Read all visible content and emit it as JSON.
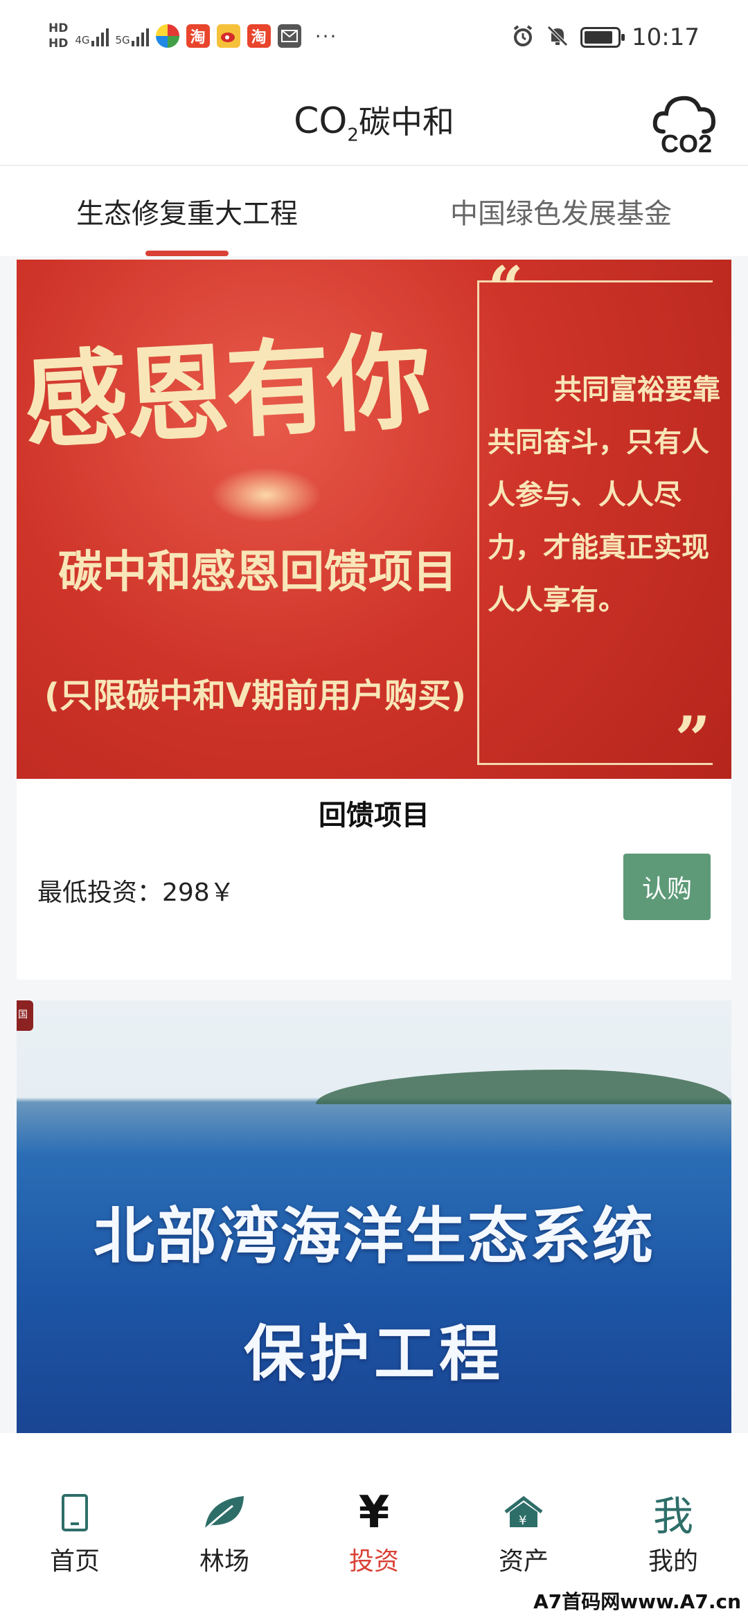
{
  "status_bar": {
    "hd1": "HD",
    "hd2": "HD",
    "net1": "4G",
    "net2": "5G",
    "taobao1": "淘",
    "taobao2": "淘",
    "more": "···",
    "time": "10:17"
  },
  "header": {
    "co2": "CO",
    "co2_sub": "2",
    "title": "碳中和",
    "icon_text": "CO2"
  },
  "tabs": [
    {
      "label": "生态修复重大工程",
      "active": true
    },
    {
      "label": "中国绿色发展基金",
      "active": false
    }
  ],
  "cards": [
    {
      "banner": {
        "big_text": "感恩有你",
        "subtitle": "碳中和感恩回馈项目",
        "note": "(只限碳中和V期前用户购买)",
        "poem": [
          "共同富裕要靠",
          "共同奋斗，只有人",
          "人参与、人人尽",
          "力，才能真正实现",
          "人人享有。"
        ]
      },
      "title": "回馈项目",
      "price": "最低投资：298￥",
      "button": "认购"
    },
    {
      "banner": {
        "badge": "国",
        "title_line1": "北部湾海洋生态系统",
        "title_line2": "保护工程"
      }
    }
  ],
  "bottom_nav": [
    {
      "label": "首页",
      "icon": "phone-icon"
    },
    {
      "label": "林场",
      "icon": "leaf-icon"
    },
    {
      "label": "投资",
      "icon": "yen-icon",
      "active": true,
      "glyph": "¥"
    },
    {
      "label": "资产",
      "icon": "house-yen-icon"
    },
    {
      "label": "我的",
      "icon": "wo-icon",
      "glyph": "我"
    }
  ],
  "watermark": "A7首码网www.A7.cn",
  "colors": {
    "accent_red": "#d94136",
    "button_green": "#5e9a78",
    "nav_teal": "#2e6e69"
  }
}
